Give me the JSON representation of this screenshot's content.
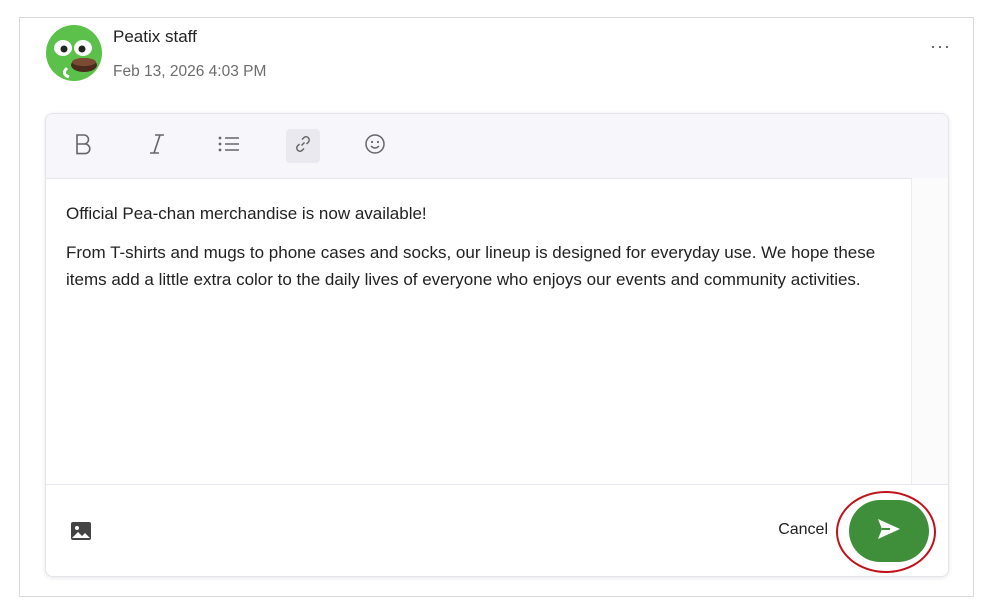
{
  "post": {
    "author": "Peatix staff",
    "timestamp": "Feb 13, 2026 4:03 PM",
    "more_menu": "···"
  },
  "toolbar": {
    "items": [
      "bold-icon",
      "italic-icon",
      "bulleted-list-icon",
      "link-icon",
      "emoji-icon"
    ],
    "active": "link-icon"
  },
  "editor": {
    "paragraphs": [
      "Official Pea-chan merchandise is now available!",
      "From T-shirts and mugs to phone cases and socks, our lineup is designed for everyday use. We hope these items add a little extra color to the daily lives of everyone who enjoys our events and community activities."
    ]
  },
  "footer": {
    "image_icon": "image-icon",
    "cancel_label": "Cancel",
    "send_icon": "send-icon"
  },
  "colors": {
    "send_button": "#3f8f3a",
    "highlight_ring": "#c0121b",
    "avatar_green": "#5cc14a"
  }
}
